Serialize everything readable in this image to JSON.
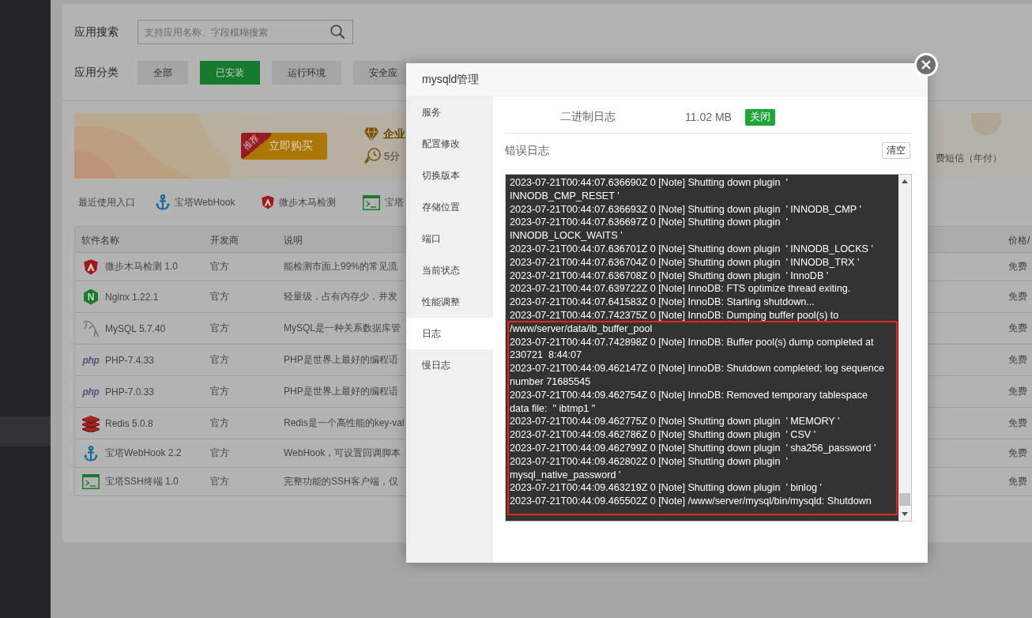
{
  "search": {
    "label": "应用搜索",
    "placeholder": "支持应用名称、字段模糊搜索"
  },
  "categories": {
    "label": "应用分类",
    "items": [
      {
        "label": "全部",
        "selected": false
      },
      {
        "label": "已安装",
        "selected": true
      },
      {
        "label": "运行环境",
        "selected": false
      },
      {
        "label": "安全应",
        "selected": false
      }
    ]
  },
  "banner": {
    "ribbon": "推荐",
    "buy_button": "立即购买",
    "feature_title": "企业",
    "feature_subtitle": "5分",
    "side_text": "费短信（年付）"
  },
  "recent": {
    "label": "最近使用入口",
    "items": [
      "宝塔WebHook",
      "微步木马检测",
      "宝塔"
    ]
  },
  "table": {
    "columns": [
      "软件名称",
      "开发商",
      "说明",
      "价格/"
    ],
    "rows": [
      {
        "name": "微步木马检测 1.0",
        "developer": "官方",
        "description": "能检测市面上99%的常见流",
        "price": "免费"
      },
      {
        "logo_text": "N",
        "name": "Nginx 1.22.1",
        "developer": "官方",
        "description": "轻量级，占有内存少，并发",
        "price": "免费"
      },
      {
        "name": "MySQL 5.7.40",
        "developer": "官方",
        "description": "MySQL是一种关系数据库管",
        "price": "免费"
      },
      {
        "logo_text": "php",
        "name": "PHP-7.4.33",
        "developer": "官方",
        "description": "PHP是世界上最好的编程语",
        "price": "免费"
      },
      {
        "logo_text": "php",
        "name": "PHP-7.0.33",
        "developer": "官方",
        "description": "PHP是世界上最好的编程语",
        "price": "免费"
      },
      {
        "name": "Redis 5.0.8",
        "developer": "官方",
        "description": "Redis是一个高性能的key-val",
        "price": "免费"
      },
      {
        "name": "宝塔WebHook 2.2",
        "developer": "官方",
        "description": "WebHook，可设置回调脚本",
        "price": "免费"
      },
      {
        "name": "宝塔SSH终端 1.0",
        "developer": "官方",
        "description": "完整功能的SSH客户端，仅",
        "price": "免费"
      }
    ]
  },
  "dialog": {
    "title": "mysqld管理",
    "nav": [
      {
        "label": "服务",
        "selected": false
      },
      {
        "label": "配置修改",
        "selected": false
      },
      {
        "label": "切换版本",
        "selected": false
      },
      {
        "label": "存储位置",
        "selected": false
      },
      {
        "label": "端口",
        "selected": false
      },
      {
        "label": "当前状态",
        "selected": false
      },
      {
        "label": "性能调整",
        "selected": false
      },
      {
        "label": "日志",
        "selected": true
      },
      {
        "label": "慢日志",
        "selected": false
      }
    ],
    "binlog": {
      "label": "二进制日志",
      "size": "11.02 MB",
      "toggle_button": "关闭"
    },
    "error_log": {
      "label": "错误日志",
      "clear_button": "清空",
      "lines": [
        "2023-07-21T00:44:07.636690Z 0 [Note] Shutting down plugin  '",
        "INNODB_CMP_RESET '",
        "2023-07-21T00:44:07.636693Z 0 [Note] Shutting down plugin  ' INNODB_CMP '",
        "2023-07-21T00:44:07.636697Z 0 [Note] Shutting down plugin  '",
        "INNODB_LOCK_WAITS '",
        "2023-07-21T00:44:07.636701Z 0 [Note] Shutting down plugin  ' INNODB_LOCKS '",
        "2023-07-21T00:44:07.636704Z 0 [Note] Shutting down plugin  ' INNODB_TRX '",
        "2023-07-21T00:44:07.636708Z 0 [Note] Shutting down plugin  ' InnoDB '",
        "2023-07-21T00:44:07.639722Z 0 [Note] InnoDB: FTS optimize thread exiting.",
        "2023-07-21T00:44:07.641583Z 0 [Note] InnoDB: Starting shutdown...",
        "2023-07-21T00:44:07.742375Z 0 [Note] InnoDB: Dumping buffer pool(s) to"
      ],
      "highlighted_lines": [
        "/www/server/data/ib_buffer_pool",
        "2023-07-21T00:44:07.742898Z 0 [Note] InnoDB: Buffer pool(s) dump completed at",
        "230721  8:44:07",
        "2023-07-21T00:44:09.462147Z 0 [Note] InnoDB: Shutdown completed; log sequence",
        "number 71685545",
        "2023-07-21T00:44:09.462754Z 0 [Note] InnoDB: Removed temporary tablespace",
        "data file:  \" ibtmp1 \"",
        "2023-07-21T00:44:09.462775Z 0 [Note] Shutting down plugin  ' MEMORY '",
        "2023-07-21T00:44:09.462786Z 0 [Note] Shutting down plugin  ' CSV '",
        "2023-07-21T00:44:09.462799Z 0 [Note] Shutting down plugin  ' sha256_password '",
        "2023-07-21T00:44:09.462802Z 0 [Note] Shutting down plugin  '",
        "mysql_native_password '",
        "2023-07-21T00:44:09.463219Z 0 [Note] Shutting down plugin  ' binlog '",
        "2023-07-21T00:44:09.465502Z 0 [Note] /www/server/mysql/bin/mysqld: Shutdown"
      ]
    }
  }
}
